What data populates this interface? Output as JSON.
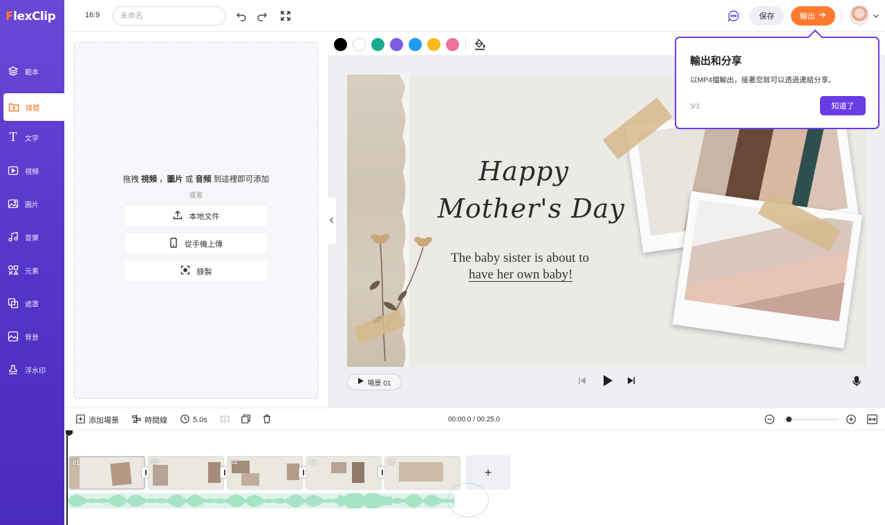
{
  "app": {
    "brand_f": "F",
    "brand_rest": "lexClip",
    "accent": "#6a48d7",
    "export_color": "#ff7a2e"
  },
  "sidebar": {
    "items": [
      {
        "label": "範本",
        "icon": "layers-icon"
      },
      {
        "label": "媒體",
        "icon": "media-upload-icon",
        "active": true
      },
      {
        "label": "文字",
        "icon": "text-icon"
      },
      {
        "label": "視頻",
        "icon": "video-icon"
      },
      {
        "label": "圖片",
        "icon": "image-icon"
      },
      {
        "label": "音樂",
        "icon": "music-icon"
      },
      {
        "label": "元素",
        "icon": "elements-icon"
      },
      {
        "label": "遮罩",
        "icon": "mask-icon"
      },
      {
        "label": "背景",
        "icon": "background-icon"
      },
      {
        "label": "浮水印",
        "icon": "watermark-stamp-icon"
      }
    ]
  },
  "topbar": {
    "ratio": "16:9",
    "title_placeholder": "未命名",
    "save_label": "保存",
    "export_label": "輸出"
  },
  "media_panel": {
    "drop_pre": "拖拽 ",
    "drop_video": "視頻",
    "drop_sep": " ，",
    "drop_image": "圖片",
    "drop_or_inline": " 或 ",
    "drop_audio": "音頻",
    "drop_post": " 到這裡即可添加",
    "or": "或者",
    "local_file": "本地文件",
    "phone_upload": "從手機上傳",
    "record": "錄製"
  },
  "colorbar": {
    "swatches": [
      "#000000",
      "#ffffff",
      "#1aac8f",
      "#7b5ee0",
      "#1e9bef",
      "#fbb91f",
      "#f0729a"
    ]
  },
  "canvas": {
    "script_line1": "Happy",
    "script_line2": "Mother's Day",
    "sub_line1": "The baby sister is about to",
    "sub_line2": "have her own baby!",
    "scene_label": "場景 01"
  },
  "tooltip": {
    "title": "輸出和分享",
    "body": "以MP4檔輸出，接著您就可以透過連結分享。",
    "step": "3/3",
    "button": "知道了"
  },
  "timeline_bar": {
    "add_scene": "添加場景",
    "timeline": "時間線",
    "duration": "5.0s",
    "time": "00:00.0 / 00:25.0",
    "zoom_level": 0.1
  },
  "timeline": {
    "clips": [
      "01",
      "02",
      "03",
      "04",
      "05"
    ],
    "add": "+"
  }
}
